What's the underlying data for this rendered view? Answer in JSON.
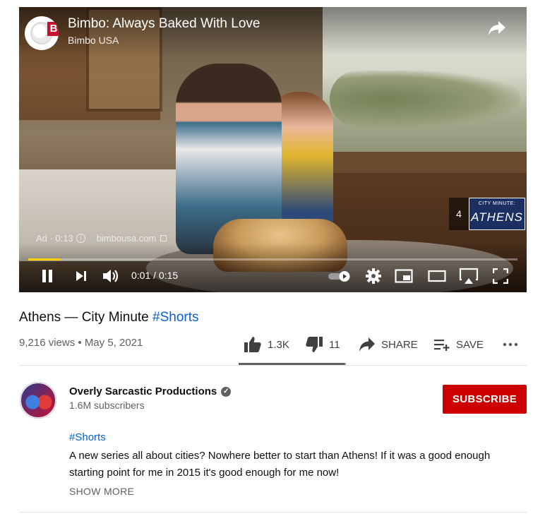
{
  "ad": {
    "title": "Bimbo: Always Baked With Love",
    "channel": "Bimbo USA",
    "logo_letter": "B",
    "info_prefix": "Ad · 0:13",
    "info_icon": "i",
    "domain": "bimbousa.com",
    "skip_count": "4",
    "next_video_small": "CITY MINUTE:",
    "next_video_big": "ATHENS"
  },
  "player": {
    "time": "0:01 / 0:15",
    "progress_fraction": 0.067,
    "colors": {
      "progress": "#ffcc00"
    }
  },
  "video": {
    "title_main": "Athens — City Minute ",
    "title_tag": "#Shorts",
    "views": "9,216 views",
    "separator": " • ",
    "date": "May 5, 2021"
  },
  "actions": {
    "likes": "1.3K",
    "dislikes": "11",
    "share_label": "SHARE",
    "save_label": "SAVE",
    "like_ratio": 0.99
  },
  "channel": {
    "name": "Overly Sarcastic Productions",
    "verified_mark": "✓",
    "subscribers": "1.6M subscribers",
    "subscribe_label": "SUBSCRIBE",
    "colors": {
      "subscribe": "#cc0000"
    }
  },
  "description": {
    "tag": "#Shorts",
    "text": "A new series all about cities? Nowhere better to start than Athens! If it was a good enough starting point for me in 2015 it's good enough for me now!",
    "show_more": "SHOW MORE"
  }
}
